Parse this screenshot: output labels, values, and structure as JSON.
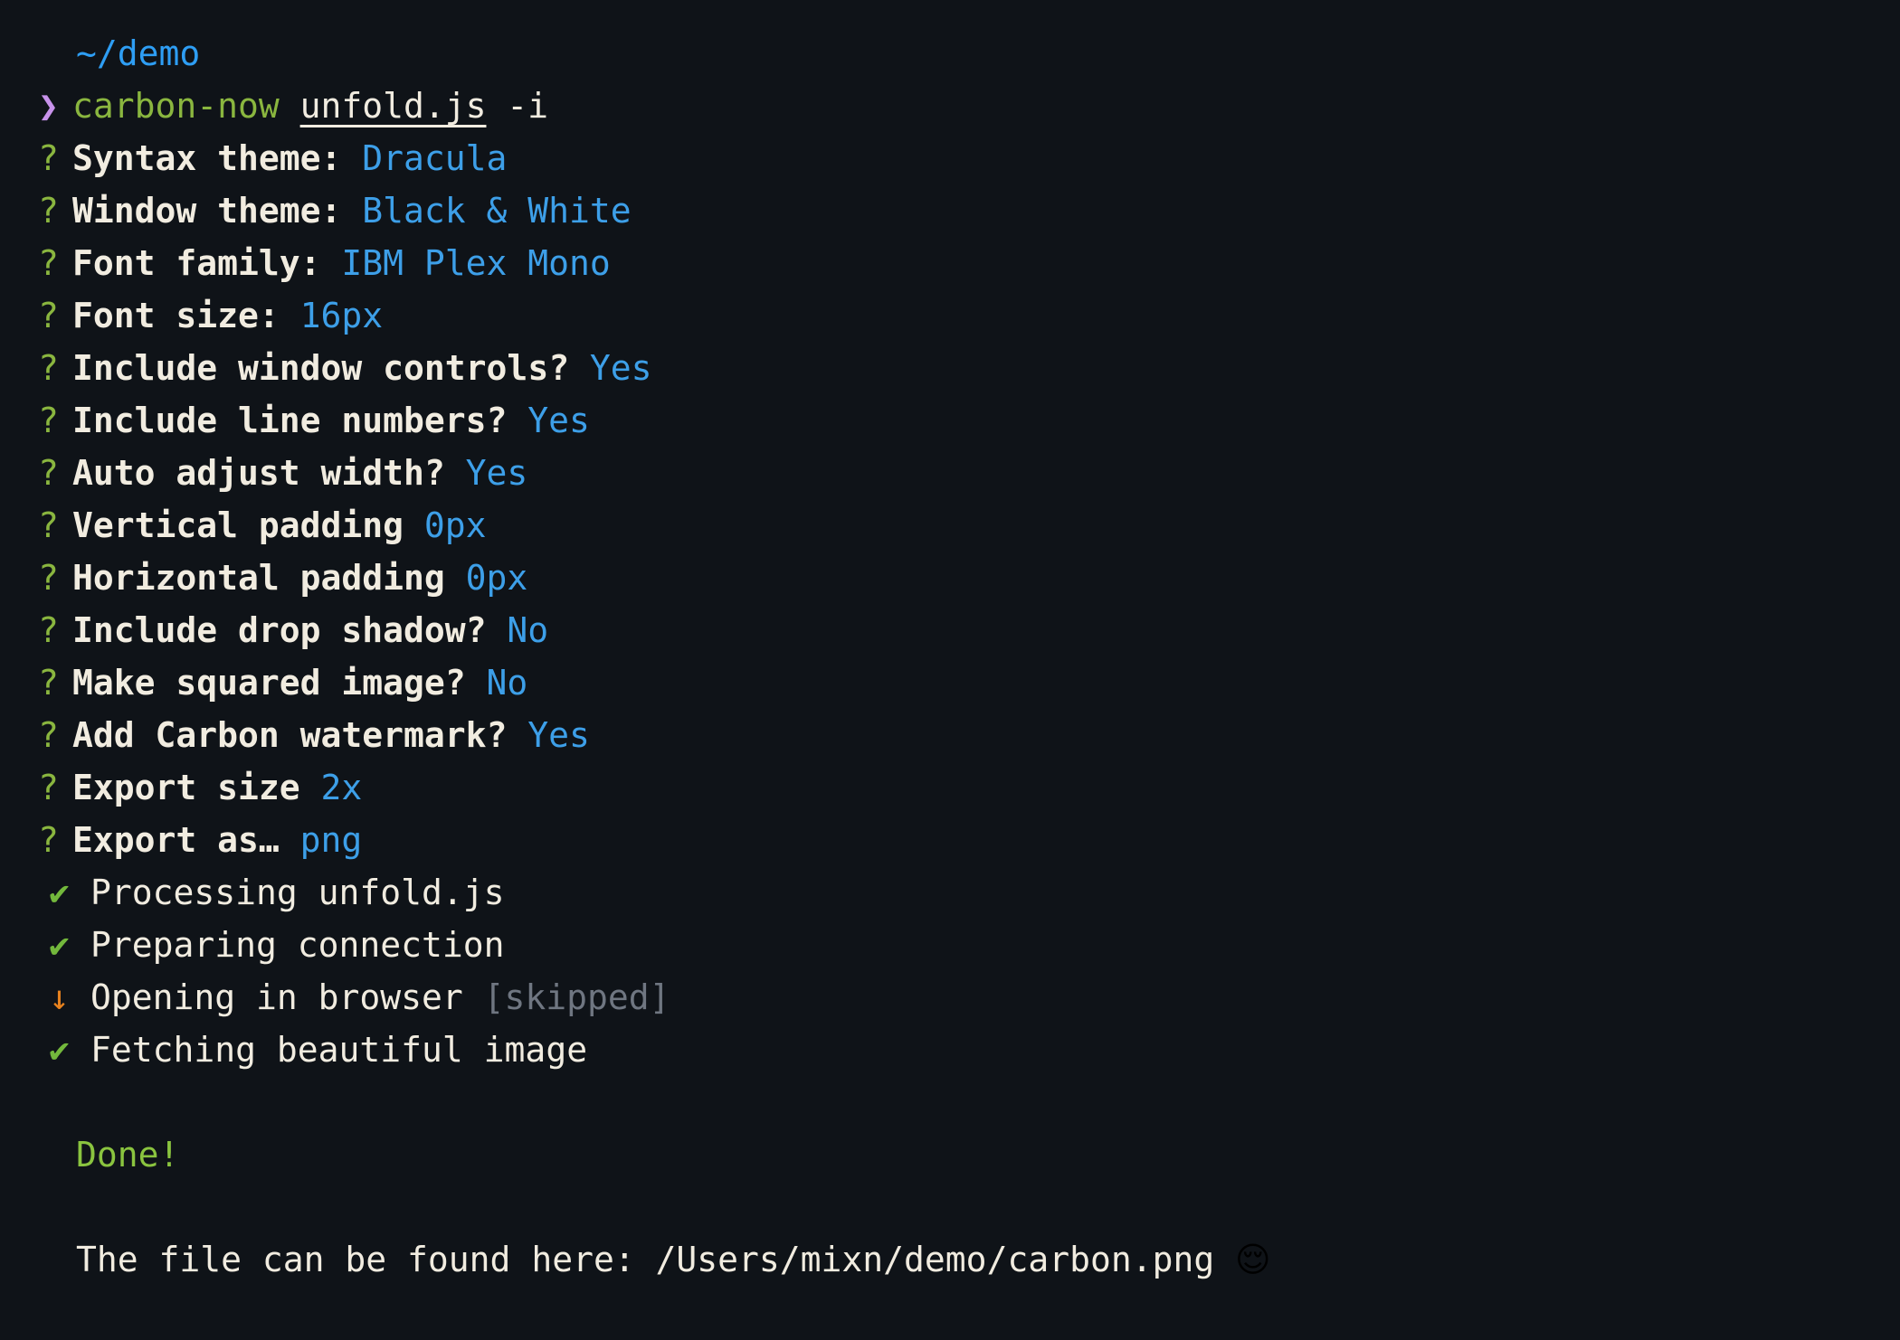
{
  "terminal": {
    "cwd": "~/demo",
    "prompt_symbol": "❯",
    "command": {
      "program": "carbon-now",
      "file": "unfold.js",
      "flag": "-i"
    },
    "question_marker": "?",
    "prompts": [
      {
        "label": "Syntax theme:",
        "value": "Dracula"
      },
      {
        "label": "Window theme:",
        "value": "Black & White"
      },
      {
        "label": "Font family:",
        "value": "IBM Plex Mono"
      },
      {
        "label": "Font size:",
        "value": "16px"
      },
      {
        "label": "Include window controls?",
        "value": "Yes"
      },
      {
        "label": "Include line numbers?",
        "value": "Yes"
      },
      {
        "label": "Auto adjust width?",
        "value": "Yes"
      },
      {
        "label": "Vertical padding",
        "value": "0px"
      },
      {
        "label": "Horizontal padding",
        "value": "0px"
      },
      {
        "label": "Include drop shadow?",
        "value": "No"
      },
      {
        "label": "Make squared image?",
        "value": "No"
      },
      {
        "label": "Add Carbon watermark?",
        "value": "Yes"
      },
      {
        "label": "Export size",
        "value": "2x"
      },
      {
        "label": "Export as…",
        "value": "png"
      }
    ],
    "tasks": [
      {
        "marker": "✔",
        "marker_kind": "check",
        "text": "Processing unfold.js",
        "note": ""
      },
      {
        "marker": "✔",
        "marker_kind": "check",
        "text": "Preparing connection",
        "note": ""
      },
      {
        "marker": "↓",
        "marker_kind": "down",
        "text": "Opening in browser",
        "note": "[skipped]"
      },
      {
        "marker": "✔",
        "marker_kind": "check",
        "text": "Fetching beautiful image",
        "note": ""
      }
    ],
    "done_message": "Done!",
    "result_prefix": "The file can be found here:",
    "result_path": "/Users/mixn/demo/carbon.png",
    "result_emoji": "😌"
  },
  "colors": {
    "background": "#0f1318",
    "path": "#2e9ef4",
    "command": "#8ab63f",
    "foreground": "#f1ece0",
    "value": "#3d9fe8",
    "question": "#8ab63f",
    "check": "#73b83c",
    "down_arrow": "#e8821e",
    "skipped": "#6f7681",
    "done": "#8ac43f",
    "prompt": "#c792ea"
  }
}
